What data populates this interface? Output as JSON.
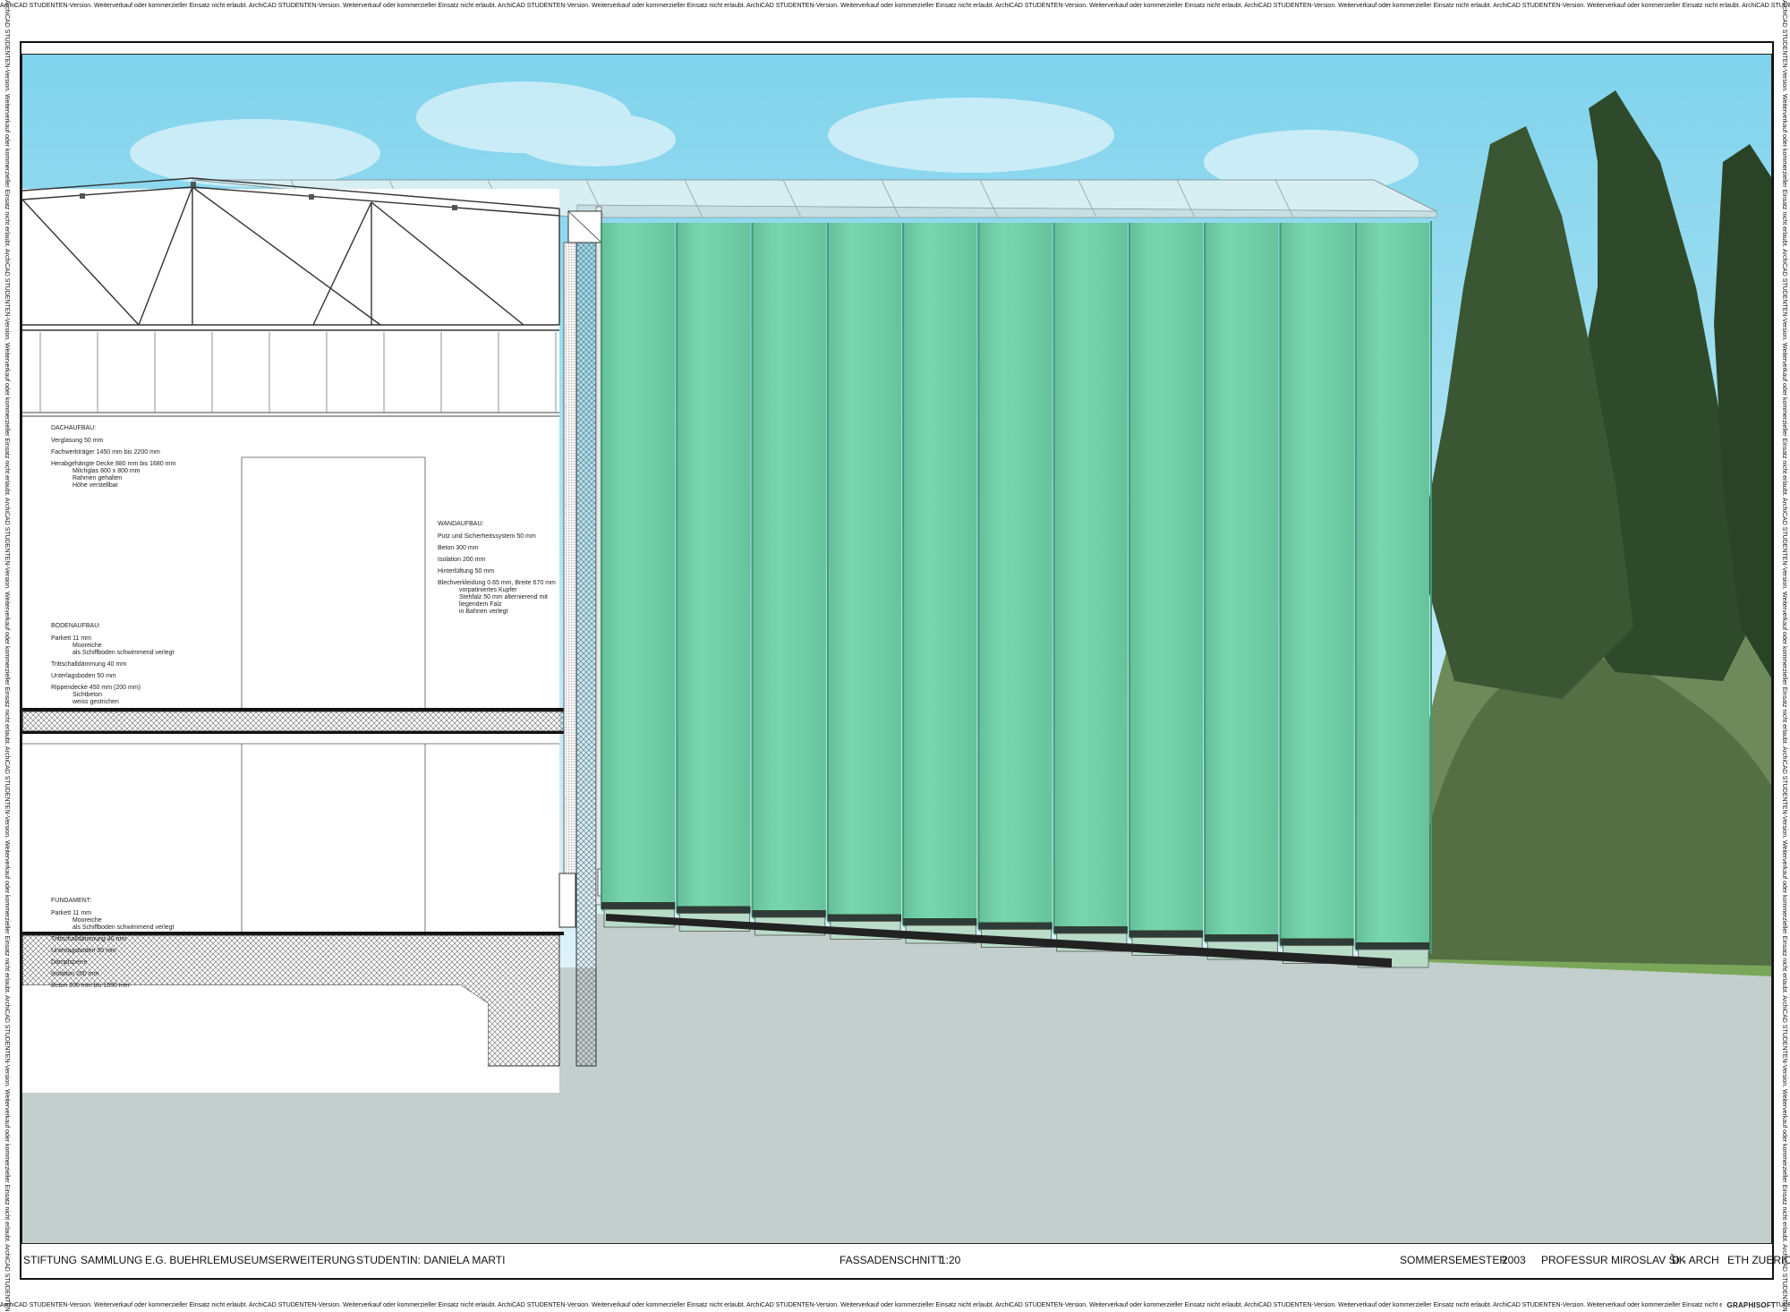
{
  "watermark": "ArchiCAD STUDENTEN-Version. Weiterverkauf oder kommerzieller Einsatz nicht erlaubt.",
  "brand": "GRAPHISOFT",
  "title_left": [
    "STIFTUNG",
    "SAMMLUNG",
    "E.G. BUEHRLE",
    "MUSEUMSERWEITERUNG",
    "STUDENTIN: DANIELA MARTI"
  ],
  "title_center": [
    "FASSADENSCHNITT",
    "1:20"
  ],
  "title_right": [
    "SOMMERSEMESTER",
    "2003",
    "PROFESSUR MIROSLAV ŠIK",
    "D - ARCH",
    "ETH ZUERICH"
  ],
  "notes": {
    "dach": {
      "heading": "DACHAUFBAU:",
      "lines": [
        [
          "Verglasung 50 mm"
        ],
        [
          "Fachwerkträger 1450 mm bis 2200 mm"
        ],
        [
          "Herabgehängte Decke 880 mm bis 1680 mm",
          "Milchglas 800 x 800 mm",
          "Rahmen gehalten",
          "Höhe verstellbar"
        ]
      ]
    },
    "wand": {
      "heading": "WANDAUFBAU:",
      "lines": [
        [
          "Putz und Sicherheitssystem 50 mm"
        ],
        [
          "Beton 300 mm"
        ],
        [
          "Isolation 200 mm"
        ],
        [
          "Hinterlüftung 50 mm"
        ],
        [
          "Blechverkleidung 0.65 mm, Breite 670 mm",
          "vorpatiniertes Kupfer",
          "Stehfalz 50 mm alternierend mit",
          "liegendem Falz",
          "in Bahnen verlegt"
        ]
      ]
    },
    "boden": {
      "heading": "BODENAUFBAU:",
      "lines": [
        [
          "Parkett 11 mm",
          "Mooreiche",
          "als Schiffboden schwimmend verlegt"
        ],
        [
          "Trittschalldämmung 40 mm"
        ],
        [
          "Unterlagsboden 50 mm"
        ],
        [
          "Rippendecke 450 mm (200 mm)",
          "Sichtbeton",
          "weiss gestrichen"
        ]
      ]
    },
    "fundament": {
      "heading": "FUNDAMENT:",
      "lines": [
        [
          "Parkett 11 mm",
          "Mooreiche",
          "als Schiffboden schwimmend verlegt"
        ],
        [
          "Trittschalldämmung 40 mm"
        ],
        [
          "Unterlagsboden 50 mm"
        ],
        [
          "Dampfsperre"
        ],
        [
          "Isolation 200 mm"
        ],
        [
          "Beton 200 mm bis 1050 mm"
        ]
      ]
    }
  },
  "colors": {
    "sky_top": "#7fd3ec",
    "sky_bottom": "#dff3fb",
    "copper_panel": "#6fd3a8",
    "copper_seam": "#3f9a76",
    "ground": "#c3cfcc",
    "foliage_dark": "#2f4a2a",
    "foliage_light": "#6f8a5a",
    "glass": "#b9dcc8"
  }
}
